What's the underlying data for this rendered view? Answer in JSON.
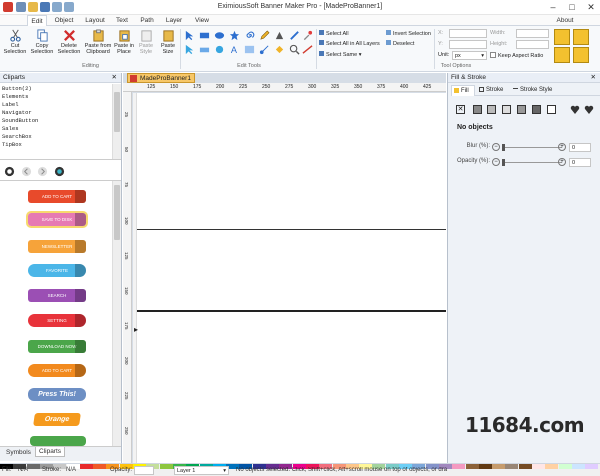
{
  "window": {
    "title": "EximiousSoft Banner Maker Pro - [MadeProBanner1]",
    "controls": [
      "–",
      "□",
      "✕"
    ]
  },
  "menu": {
    "tabs": [
      "Edit",
      "Object",
      "Layout",
      "Text",
      "Path",
      "Layer",
      "View"
    ],
    "active": "Edit",
    "about": "About"
  },
  "ribbon": {
    "editing": {
      "cut": [
        "Cut",
        "Selection"
      ],
      "copy": [
        "Copy",
        "Selection"
      ],
      "delete": [
        "Delete",
        "Selection"
      ],
      "paste_clipboard": [
        "Paste from",
        "Clipboard"
      ],
      "paste_place": [
        "Paste in",
        "Place"
      ],
      "paste_style": [
        "Paste",
        "Style"
      ],
      "paste_size": [
        "Paste",
        "Size"
      ],
      "group": "Editing"
    },
    "tools_group": "Edit Tools",
    "select": {
      "all": "Select All",
      "all_layers": "Select All in All Layers",
      "same": "Select Same",
      "invert": "Invert Selection",
      "deselect": "Deselect"
    },
    "options": {
      "x": "X:",
      "y": "Y:",
      "width": "Width:",
      "height": "Height:",
      "unit_label": "Unit:",
      "unit_value": "px",
      "keep_ratio": "Keep Aspect Ratio",
      "group": "Tool Options"
    }
  },
  "cliparts": {
    "title": "Cliparts",
    "list": [
      "Button(2)",
      "Elements",
      "Label",
      "Navigator",
      "SoundButton",
      "Sales",
      "SearchBox",
      "TipBox"
    ],
    "previews": [
      {
        "label": "ADD TO CART",
        "color": "#e84a2b"
      },
      {
        "label": "SAVE TO DISK",
        "color": "#e67ab3"
      },
      {
        "label": "NEWSLETTER",
        "color": "#f6a33a"
      },
      {
        "label": "FAVORITE",
        "color": "#4bb6e8"
      },
      {
        "label": "SEARCH",
        "color": "#9b4fb4"
      },
      {
        "label": "SETTING",
        "color": "#e8333b"
      },
      {
        "label": "DOWNLOAD NOW",
        "color": "#4ba64a"
      },
      {
        "label": "ADD TO CART",
        "color": "#f28a1e"
      },
      {
        "label": "Press This!",
        "color": "#6d8fc4"
      },
      {
        "label": "Orange",
        "color": "#f59a1d"
      }
    ],
    "bottom_tabs": [
      "Symbols",
      "Cliparts"
    ]
  },
  "document": {
    "tab": "MadeProBanner1",
    "ruler": [
      "125",
      "150",
      "175",
      "200",
      "225",
      "250",
      "275",
      "300",
      "325",
      "350",
      "375",
      "400",
      "425"
    ],
    "vruler": [
      "25",
      "50",
      "75",
      "100",
      "125",
      "150",
      "175",
      "200",
      "225",
      "250"
    ]
  },
  "fill_stroke": {
    "title": "Fill & Stroke",
    "tabs": [
      "Fill",
      "Stroke",
      "Stroke Style"
    ],
    "status": "No objects",
    "blur": {
      "label": "Blur (%):",
      "value": "0"
    },
    "opacity": {
      "label": "Opacity (%):",
      "value": "0"
    }
  },
  "statusbar": {
    "fill_label": "Fill:",
    "fill_value": "N/A",
    "stroke_label": "Stroke:",
    "stroke_value": "N/A",
    "opacity_label": "Opacity:",
    "layer": "Layer 1",
    "message": "No objects selected. Click, Shift+click, Alt+scroll mouse on top of objects, or dra"
  },
  "palette": [
    "#000000",
    "#3b3b3b",
    "#6a6a6a",
    "#9a9a9a",
    "#c8c8c8",
    "#ffffff",
    "#e82b2b",
    "#f05a28",
    "#f7941d",
    "#ffc20e",
    "#fff200",
    "#c4df9b",
    "#8dc63f",
    "#39b54a",
    "#00a651",
    "#00a99d",
    "#00aeef",
    "#0072bc",
    "#0054a6",
    "#2e3192",
    "#662d91",
    "#92278f",
    "#ec008c",
    "#ed145b",
    "#f26d7d",
    "#f69679",
    "#fdc689",
    "#fff799",
    "#a3d39c",
    "#7accc8",
    "#6dcff6",
    "#7da7d9",
    "#8493ca",
    "#a187be",
    "#f49ac1",
    "#8c6239",
    "#603913",
    "#c69c6d",
    "#998675",
    "#754c24",
    "#ffe6e6",
    "#ffd1a3",
    "#d1ffd1",
    "#cce5ff",
    "#e0ccff"
  ],
  "watermark": "11684.com"
}
